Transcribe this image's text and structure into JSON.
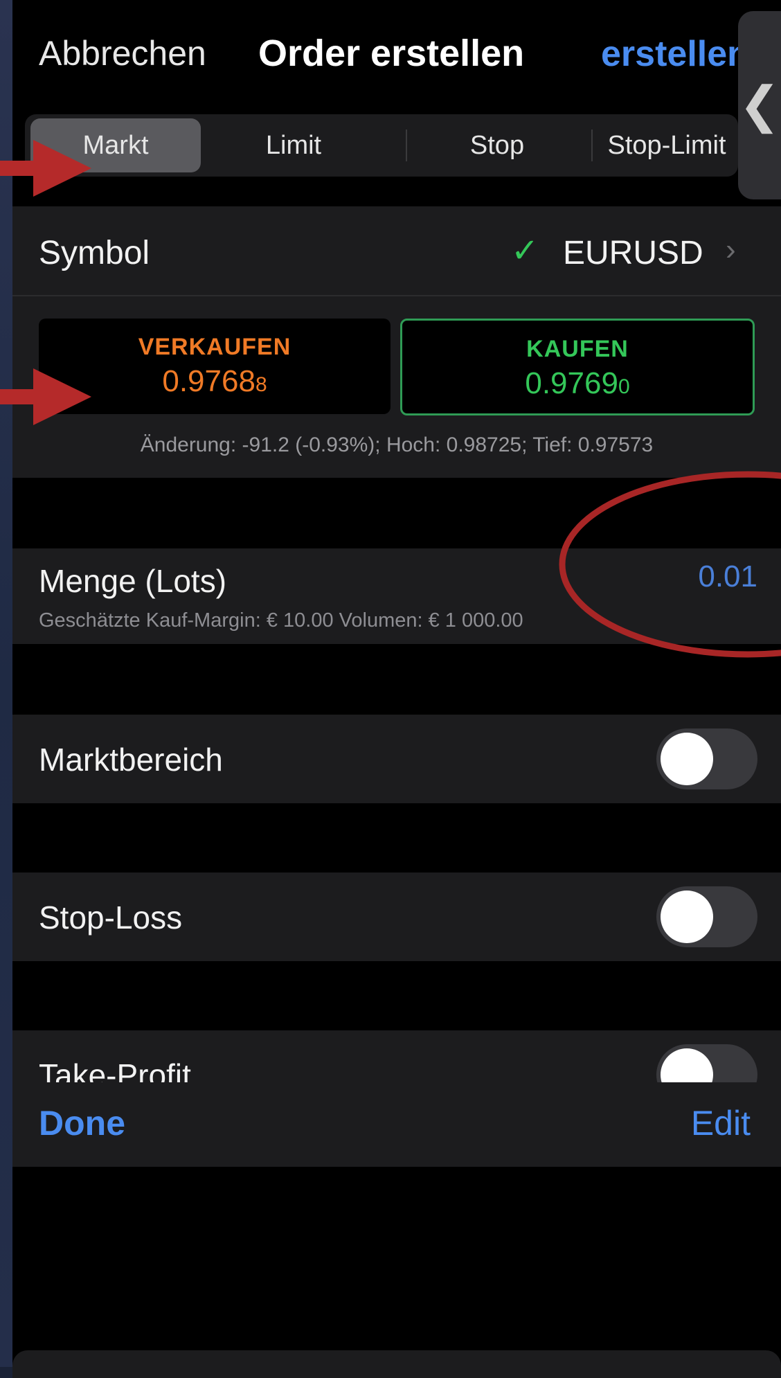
{
  "nav": {
    "cancel_label": "Abbrechen",
    "title": "Order erstellen",
    "create_label": "erstellen",
    "side_handle_glyph": "❮"
  },
  "order_types": {
    "tabs": [
      "Markt",
      "Limit",
      "Stop",
      "Stop-Limit"
    ],
    "selected": "Markt"
  },
  "symbol": {
    "label": "Symbol",
    "value": "EURUSD",
    "status_icon": "check-icon",
    "chevron": "›"
  },
  "quotes": {
    "sell": {
      "label": "VERKAUFEN",
      "price": "0.9768",
      "price_small": "8"
    },
    "buy": {
      "label": "KAUFEN",
      "price": "0.9769",
      "price_small": "0"
    },
    "change_line": "Änderung: -91.2 (-0.93%); Hoch: 0.98725; Tief: 0.97573"
  },
  "quantity": {
    "label": "Menge (Lots)",
    "value": "0.01",
    "sub": "Geschätzte Kauf-Margin: € 10.00   Volumen: € 1 000.00"
  },
  "toggles": {
    "market_range": {
      "label": "Marktbereich",
      "on": false
    },
    "stop_loss": {
      "label": "Stop-Loss",
      "on": false
    },
    "take_profit": {
      "label": "Take-Profit",
      "on": false
    }
  },
  "toolbar": {
    "done_label": "Done",
    "edit_label": "Edit"
  },
  "colors": {
    "accent_blue": "#4a8cf0",
    "sell_orange": "#f07a26",
    "buy_green": "#34c759",
    "annotation_red": "#b52a2a"
  }
}
